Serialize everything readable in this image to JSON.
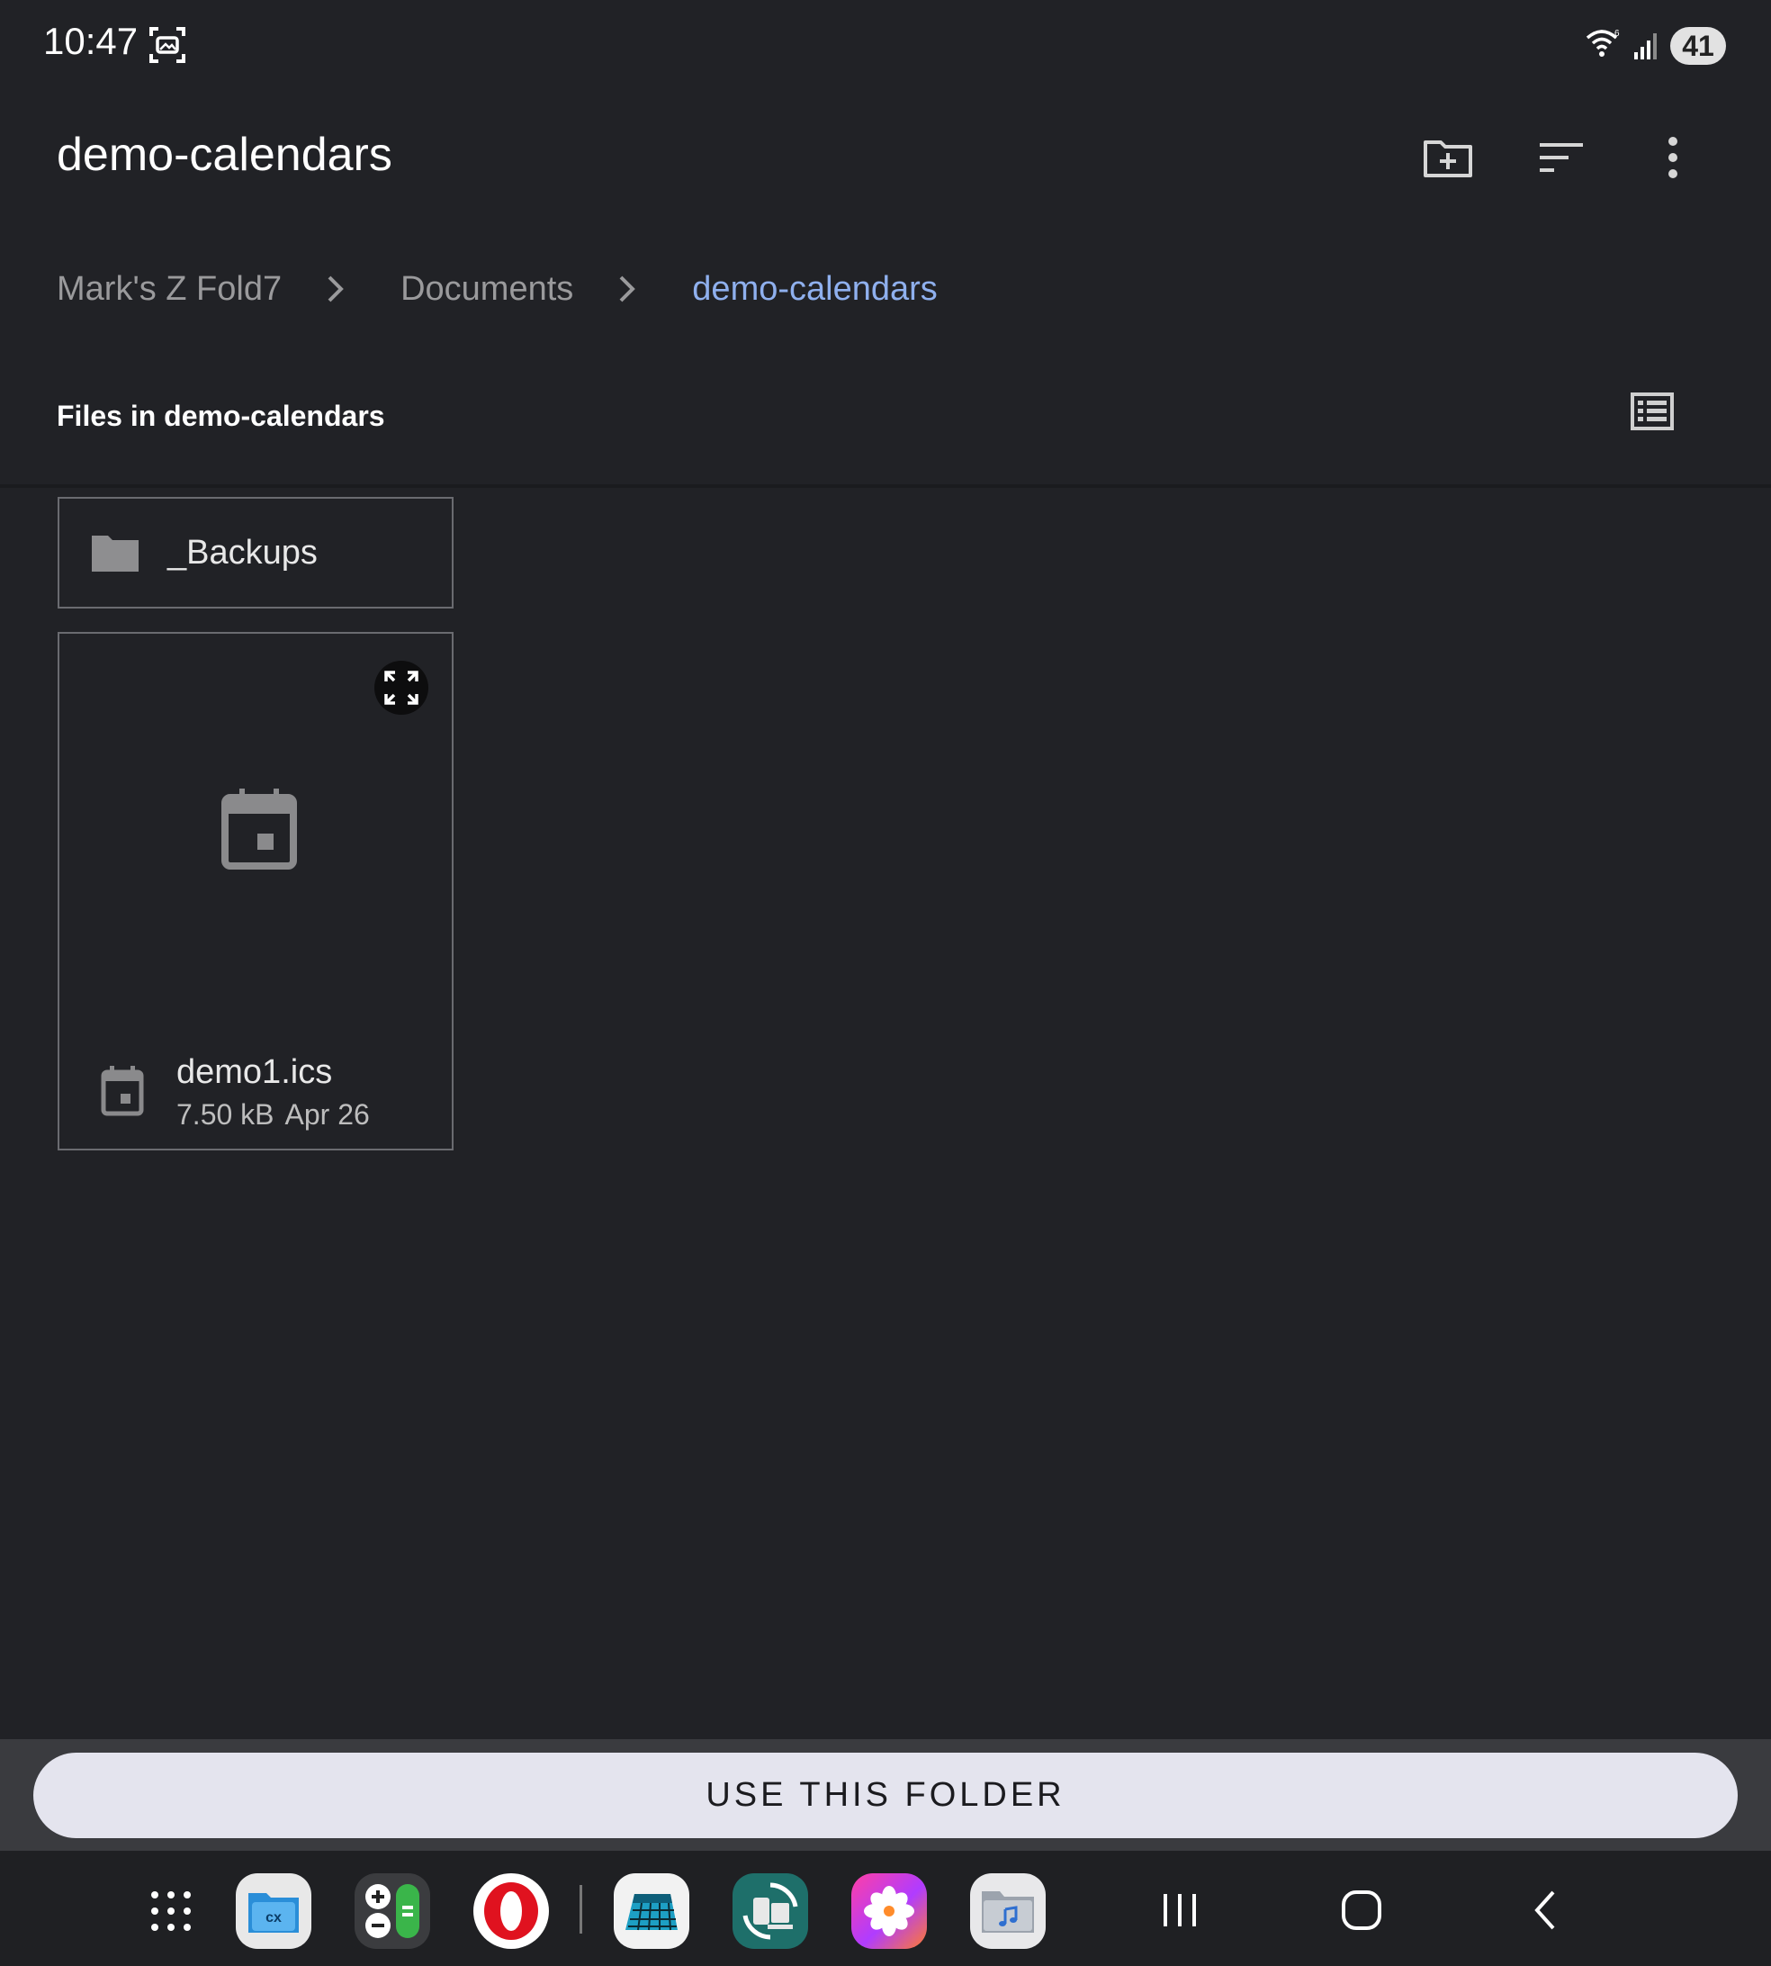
{
  "status_bar": {
    "time": "10:47",
    "battery": "41",
    "icons": [
      "screenshot-icon",
      "wifi-icon",
      "signal-icon"
    ]
  },
  "app_bar": {
    "title": "demo-calendars",
    "actions": [
      "new-folder-icon",
      "sort-icon",
      "more-options-icon"
    ]
  },
  "breadcrumb": {
    "items": [
      "Mark's Z Fold7",
      "Documents",
      "demo-calendars"
    ]
  },
  "section": {
    "header": "Files in demo-calendars",
    "view_icon": "list-view-icon"
  },
  "items": {
    "folder": {
      "name": "_Backups"
    },
    "file": {
      "name": "demo1.ics",
      "size": "7.50 kB",
      "date": "Apr 26"
    }
  },
  "action": {
    "button_label": "USE THIS FOLDER"
  },
  "dock": {
    "apps": [
      "app-drawer-icon",
      "cx-file-explorer-icon",
      "calculator-icon",
      "opera-icon",
      "calendar-app-icon",
      "sync-app-icon",
      "photos-icon",
      "music-folder-icon"
    ]
  },
  "colors": {
    "background": "#212226",
    "accent_breadcrumb": "#8fb0ee",
    "button_bg": "#e4e4ee"
  }
}
